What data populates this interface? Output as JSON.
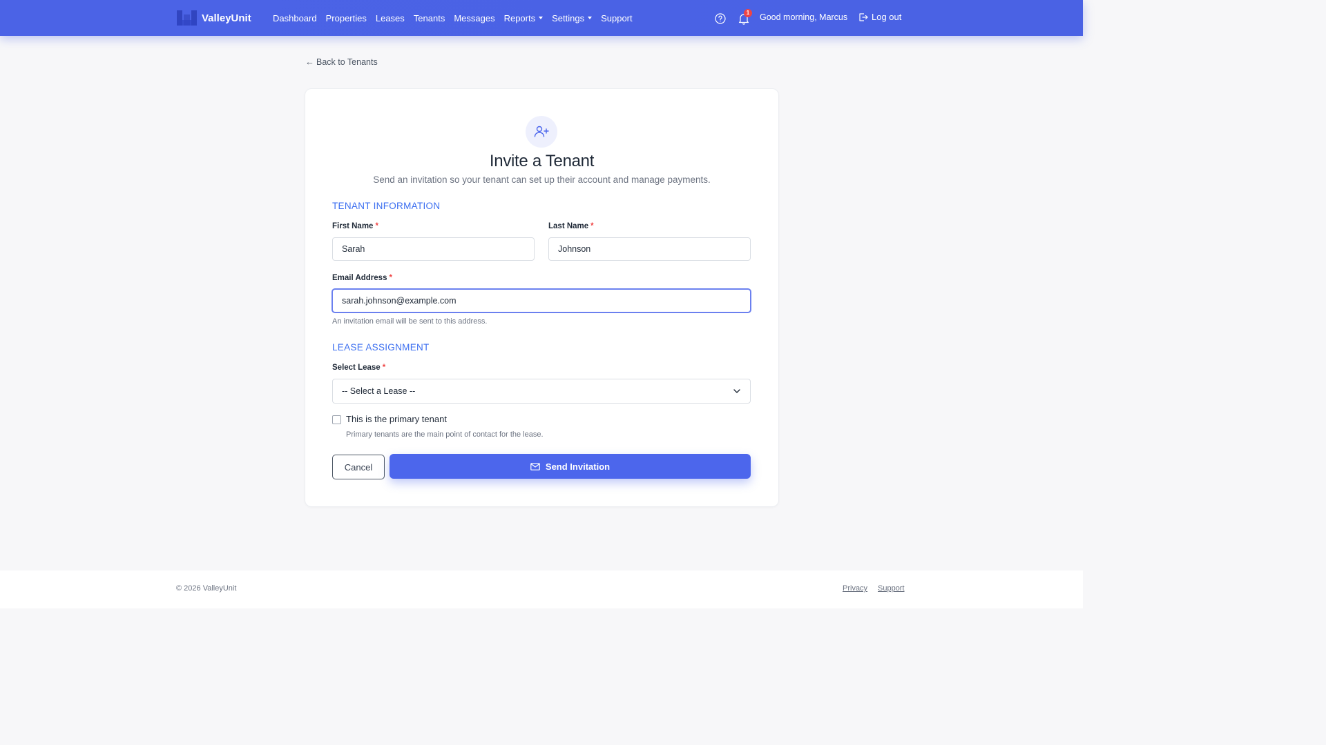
{
  "navbar": {
    "brand_name": "ValleyUnit",
    "links": [
      {
        "label": "Dashboard",
        "dropdown": false
      },
      {
        "label": "Properties",
        "dropdown": false
      },
      {
        "label": "Leases",
        "dropdown": false
      },
      {
        "label": "Tenants",
        "dropdown": false
      },
      {
        "label": "Messages",
        "dropdown": false
      },
      {
        "label": "Reports",
        "dropdown": true
      },
      {
        "label": "Settings",
        "dropdown": true
      },
      {
        "label": "Support",
        "dropdown": false
      }
    ],
    "notification_count": "1",
    "greeting": "Good morning, Marcus",
    "logout_label": "Log out",
    "icons": {
      "help": "help-circle-icon",
      "bell": "bell-icon",
      "logout": "logout-icon"
    },
    "color": "#4b63e6"
  },
  "back_link": {
    "label": "Back to Tenants"
  },
  "card": {
    "icon": "user-plus-icon",
    "title": "Invite a Tenant",
    "subtitle": "Send an invitation so your tenant can set up their account and manage payments.",
    "tenant_section": {
      "title": "TENANT INFORMATION",
      "first_name": {
        "label": "First Name",
        "value": "Sarah",
        "required": "*"
      },
      "last_name": {
        "label": "Last Name",
        "value": "Johnson",
        "required": "*"
      },
      "email": {
        "label": "Email Address",
        "value": "sarah.johnson@example.com",
        "required": "*",
        "help": "An invitation email will be sent to this address."
      }
    },
    "lease_section": {
      "title": "LEASE ASSIGNMENT",
      "select_lease": {
        "label": "Select Lease",
        "required": "*",
        "selected": "-- Select a Lease --"
      },
      "primary_checkbox": {
        "label": "This is the primary tenant",
        "help": "Primary tenants are the main point of contact for the lease.",
        "checked": false
      }
    },
    "cancel_label": "Cancel",
    "send_label": "Send Invitation",
    "accent_color": "#4c66ec",
    "section_color": "#3b6ef0"
  },
  "footer": {
    "copyright": "© 2026 ValleyUnit",
    "links": [
      "Privacy",
      "Support"
    ]
  }
}
